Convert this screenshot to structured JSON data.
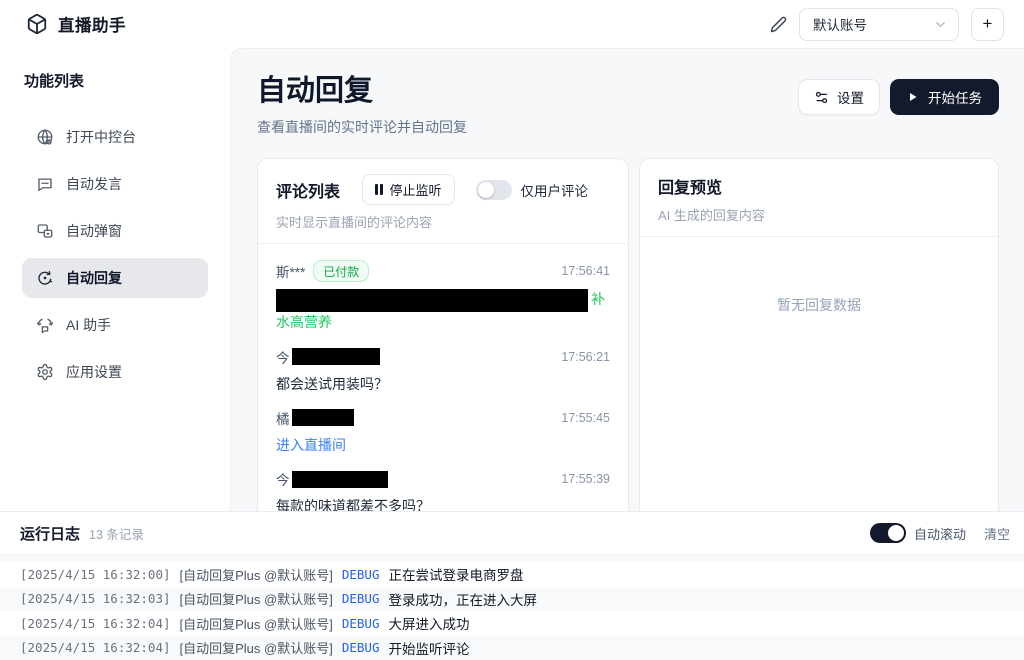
{
  "header": {
    "app_title": "直播助手",
    "account_selected": "默认账号",
    "add_button": "+"
  },
  "sidebar": {
    "title": "功能列表",
    "items": [
      {
        "label": "打开中控台"
      },
      {
        "label": "自动发言"
      },
      {
        "label": "自动弹窗"
      },
      {
        "label": "自动回复"
      },
      {
        "label": "AI 助手"
      },
      {
        "label": "应用设置"
      }
    ]
  },
  "main": {
    "title": "自动回复",
    "subtitle": "查看直播间的实时评论并自动回复",
    "settings_button": "设置",
    "start_button": "开始任务",
    "comments_panel": {
      "title": "评论列表",
      "stop_button": "停止监听",
      "user_only_toggle_label": "仅用户评论",
      "user_only_toggle_state": "off",
      "subtitle": "实时显示直播间的评论内容",
      "comments": [
        {
          "name": "斯***",
          "badge": "已付款",
          "time": "17:56:41",
          "content_redacted_suffix": "补",
          "content_line2": "水高营养"
        },
        {
          "name": "今",
          "time": "17:56:21",
          "content": "都会送试用装吗？"
        },
        {
          "name": "橘",
          "time": "17:55:45",
          "content": "进入直播间"
        },
        {
          "name": "今",
          "time": "17:55:39",
          "content": "每款的味道都差不多吗？"
        }
      ]
    },
    "reply_panel": {
      "title": "回复预览",
      "subtitle": "AI 生成的回复内容",
      "empty_text": "暂无回复数据"
    }
  },
  "logs": {
    "title": "运行日志",
    "count_text": "13 条记录",
    "autoscroll_label": "自动滚动",
    "autoscroll_state": "on",
    "clear_label": "清空",
    "rows": [
      {
        "ts": "[2025/4/15 16:32:00]",
        "tag": "[自动回复Plus @默认账号]",
        "level": "DEBUG",
        "msg": "正在尝试登录电商罗盘"
      },
      {
        "ts": "[2025/4/15 16:32:03]",
        "tag": "[自动回复Plus @默认账号]",
        "level": "DEBUG",
        "msg": "登录成功，正在进入大屏"
      },
      {
        "ts": "[2025/4/15 16:32:04]",
        "tag": "[自动回复Plus @默认账号]",
        "level": "DEBUG",
        "msg": "大屏进入成功"
      },
      {
        "ts": "[2025/4/15 16:32:04]",
        "tag": "[自动回复Plus @默认账号]",
        "level": "DEBUG",
        "msg": "开始监听评论"
      }
    ]
  },
  "colors": {
    "primary_dark": "#121a2b",
    "success_green": "#22c55e",
    "badge_green": "#16a34a",
    "link_blue": "#3b82f6",
    "debug_blue": "#2563eb",
    "content_bg": "#f7f8fa"
  }
}
